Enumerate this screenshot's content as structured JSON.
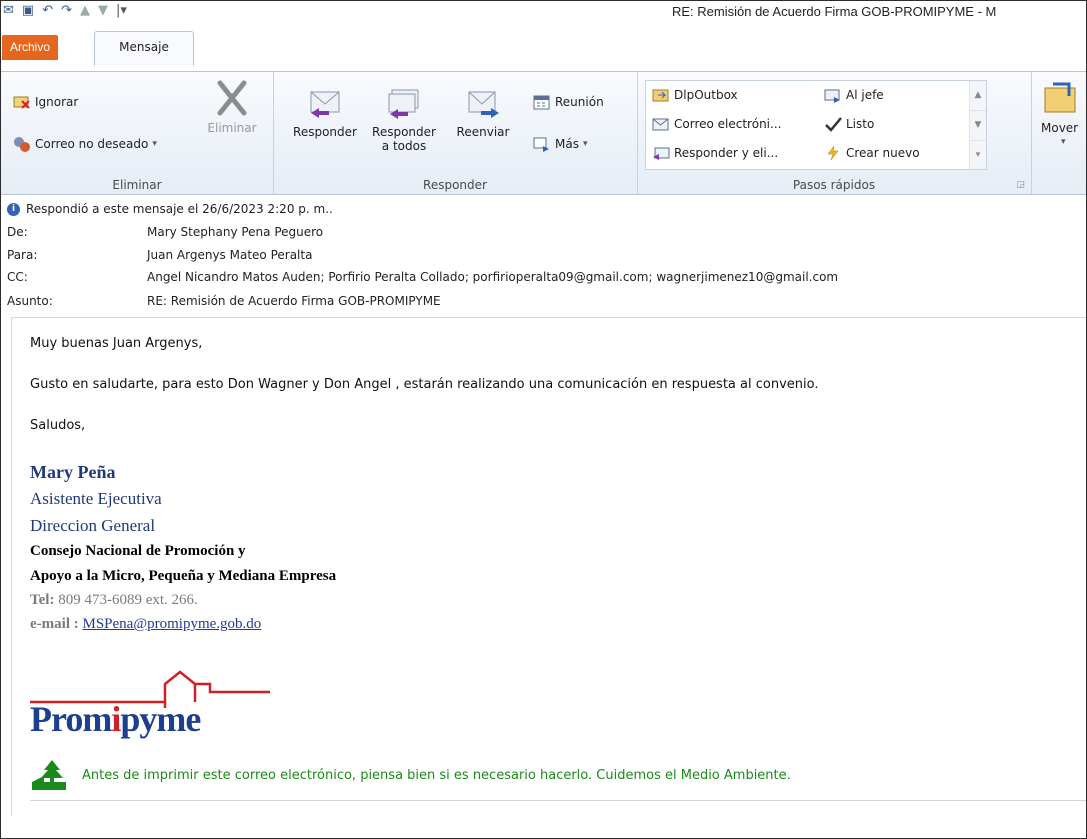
{
  "window": {
    "title": "RE: Remisión de Acuerdo Firma GOB-PROMIPYME  -  M"
  },
  "tabs": {
    "file": "Archivo",
    "message": "Mensaje"
  },
  "ribbon": {
    "delete_group": {
      "label": "Eliminar",
      "ignore": "Ignorar",
      "junk": "Correo no deseado",
      "delete": "Eliminar"
    },
    "respond_group": {
      "label": "Responder",
      "reply": "Responder",
      "reply_all_1": "Responder",
      "reply_all_2": "a todos",
      "forward": "Reenviar",
      "meeting": "Reunión",
      "more": "Más"
    },
    "quick_steps": {
      "label": "Pasos rápidos",
      "items": [
        "DlpOutbox",
        "Al jefe",
        "Correo electróni...",
        "Listo",
        "Responder y eli...",
        "Crear nuevo"
      ]
    },
    "move": {
      "label": "Mover"
    }
  },
  "message": {
    "info": "Respondió a este mensaje el 26/6/2023 2:20 p. m..",
    "from_label": "De:",
    "from": "Mary Stephany Pena Peguero",
    "to_label": "Para:",
    "to": "Juan Argenys Mateo Peralta",
    "cc_label": "CC:",
    "cc": "Angel Nicandro Matos Auden; Porfirio Peralta Collado; porfirioperalta09@gmail.com; wagnerjimenez10@gmail.com",
    "subject_label": "Asunto:",
    "subject": "RE: Remisión de Acuerdo Firma GOB-PROMIPYME"
  },
  "body": {
    "greeting": "Muy buenas Juan Argenys,",
    "paragraph": "Gusto en saludarte, para esto Don Wagner y Don Angel , estarán realizando una comunicación en respuesta al convenio.",
    "closing": "Saludos,"
  },
  "signature": {
    "name": "Mary Peña",
    "role": "Asistente Ejecutiva",
    "department": "Direccion General",
    "org_line1": "Consejo Nacional de Promoción y",
    "org_line2": "Apoyo a la Micro, Pequeña y Mediana Empresa",
    "tel_label": "Tel:",
    "tel": "809 473-6089 ext. 266.",
    "email_label": "e-mail :",
    "email": "MSPena@promipyme.gob.do",
    "logo_prefix": "Prom",
    "logo_i": "i",
    "logo_suffix": "pyme",
    "eco_note": "Antes de imprimir este correo electrónico, piensa bien si es necesario hacerlo. Cuidemos el Medio Ambiente."
  }
}
